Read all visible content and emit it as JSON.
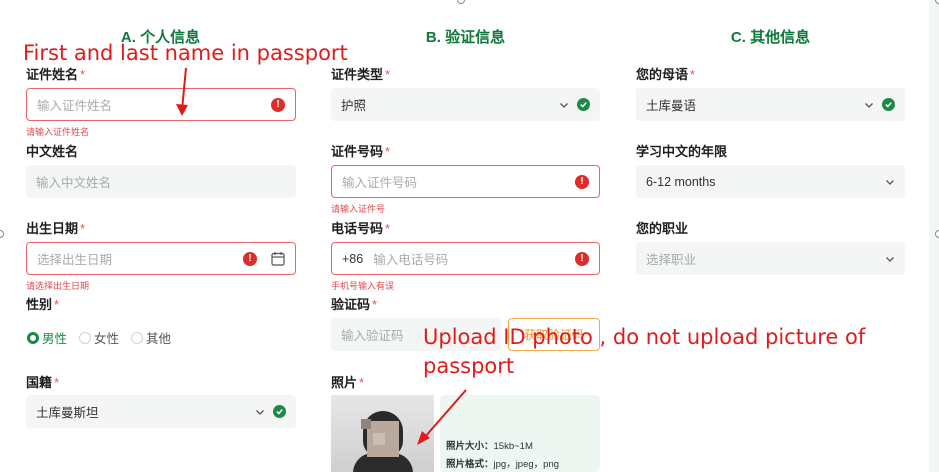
{
  "sections": {
    "personal": "A. 个人信息",
    "verification": "B. 验证信息",
    "other": "C. 其他信息"
  },
  "personal": {
    "id_name_label": "证件姓名",
    "id_name_placeholder": "输入证件姓名",
    "id_name_error": "请输入证件姓名",
    "chinese_name_label": "中文姓名",
    "chinese_name_placeholder": "输入中文姓名",
    "birth_label": "出生日期",
    "birth_placeholder": "选择出生日期",
    "birth_error": "请选择出生日期",
    "gender_label": "性别",
    "gender_options": [
      "男性",
      "女性",
      "其他"
    ],
    "nationality_label": "国籍",
    "nationality_value": "土库曼斯坦"
  },
  "verification": {
    "id_type_label": "证件类型",
    "id_type_value": "护照",
    "id_number_label": "证件号码",
    "id_number_placeholder": "输入证件号码",
    "id_number_error": "请输入证件号",
    "phone_label": "电话号码",
    "phone_prefix": "+86",
    "phone_placeholder": "输入电话号码",
    "phone_error": "手机号输入有误",
    "code_label": "验证码",
    "code_placeholder": "输入验证码",
    "code_button": "获取验证码",
    "photo_label": "照片",
    "photo_size_label": "照片大小：",
    "photo_size_value": "15kb~1M",
    "photo_format_label": "照片格式：",
    "photo_format_value": "jpg，jpeg，png"
  },
  "other": {
    "native_language_label": "您的母语",
    "native_language_value": "土库曼语",
    "study_years_label": "学习中文的年限",
    "study_years_value": "6-12 months",
    "occupation_label": "您的职业",
    "occupation_placeholder": "选择职业"
  },
  "annotations": {
    "name_note": "First and last name in passport",
    "photo_note_line1": "Upload ID photo , do not upload picture of",
    "photo_note_line2": "passport"
  },
  "required_mark": "*",
  "colors": {
    "brand_green": "#0f7a3a",
    "error_red": "#e02b2b",
    "annotation_red": "#e11b1b",
    "button_orange": "#f0a94c"
  },
  "icons": [
    "error-icon",
    "check-circle-icon",
    "chevron-down-icon",
    "calendar-icon",
    "radio-icon"
  ]
}
